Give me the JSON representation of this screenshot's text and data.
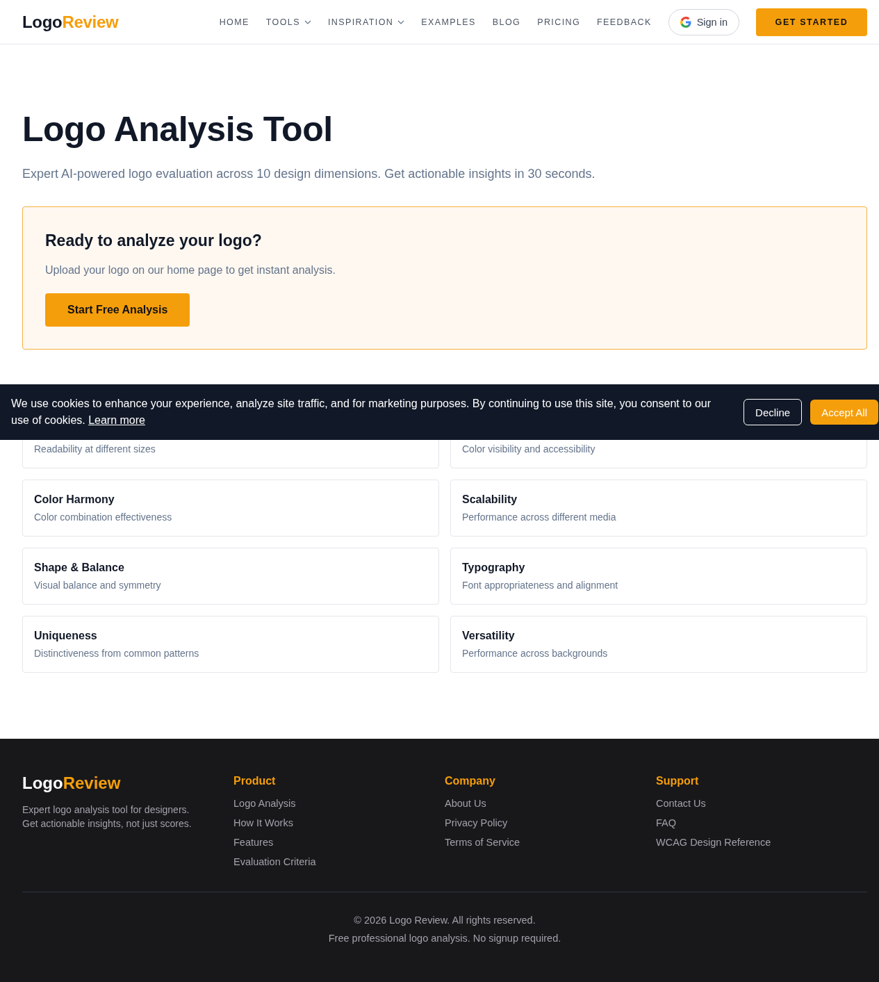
{
  "header": {
    "logo": {
      "part1": "Logo",
      "part2": "Review"
    },
    "nav": [
      {
        "label": "HOME",
        "dropdown": false
      },
      {
        "label": "TOOLS",
        "dropdown": true
      },
      {
        "label": "INSPIRATION",
        "dropdown": true
      },
      {
        "label": "EXAMPLES",
        "dropdown": false
      },
      {
        "label": "BLOG",
        "dropdown": false
      },
      {
        "label": "PRICING",
        "dropdown": false
      },
      {
        "label": "FEEDBACK",
        "dropdown": false
      }
    ],
    "sign_in": "Sign in",
    "cta": "GET STARTED"
  },
  "hero": {
    "title": "Logo Analysis Tool",
    "subtitle": "Expert AI-powered logo evaluation across 10 design dimensions. Get actionable insights in 30 seconds."
  },
  "upload_card": {
    "title": "Ready to analyze your logo?",
    "text": "Upload your logo on our home page to get instant analysis.",
    "button": "Start Free Analysis"
  },
  "analyze": {
    "cards": [
      {
        "description": "Readability at different sizes"
      },
      {
        "description": "Color visibility and accessibility"
      },
      {
        "title": "Color Harmony",
        "description": "Color combination effectiveness"
      },
      {
        "title": "Scalability",
        "description": "Performance across different media"
      },
      {
        "title": "Shape & Balance",
        "description": "Visual balance and symmetry"
      },
      {
        "title": "Typography",
        "description": "Font appropriateness and alignment"
      },
      {
        "title": "Uniqueness",
        "description": "Distinctiveness from common patterns"
      },
      {
        "title": "Versatility",
        "description": "Performance across backgrounds"
      }
    ]
  },
  "cookie_banner": {
    "text": "We use cookies to enhance your experience, analyze site traffic, and for marketing purposes. By continuing to use this site, you consent to our use of cookies.",
    "link": "Learn more",
    "decline": "Decline",
    "accept": "Accept All"
  },
  "footer": {
    "logo": {
      "part1": "Logo",
      "part2": "Review"
    },
    "tagline": [
      "Expert logo analysis tool for designers.",
      "Get actionable insights, not just scores."
    ],
    "columns": [
      {
        "heading": "Product",
        "links": [
          "Logo Analysis",
          "How It Works",
          "Features",
          "Evaluation Criteria"
        ]
      },
      {
        "heading": "Company",
        "links": [
          "About Us",
          "Privacy Policy",
          "Terms of Service"
        ]
      },
      {
        "heading": "Support",
        "links": [
          "Contact Us",
          "FAQ",
          "WCAG Design Reference"
        ]
      }
    ],
    "copyright": "© 2026 Logo Review. All rights reserved.",
    "note": "Free professional logo analysis. No signup required."
  }
}
